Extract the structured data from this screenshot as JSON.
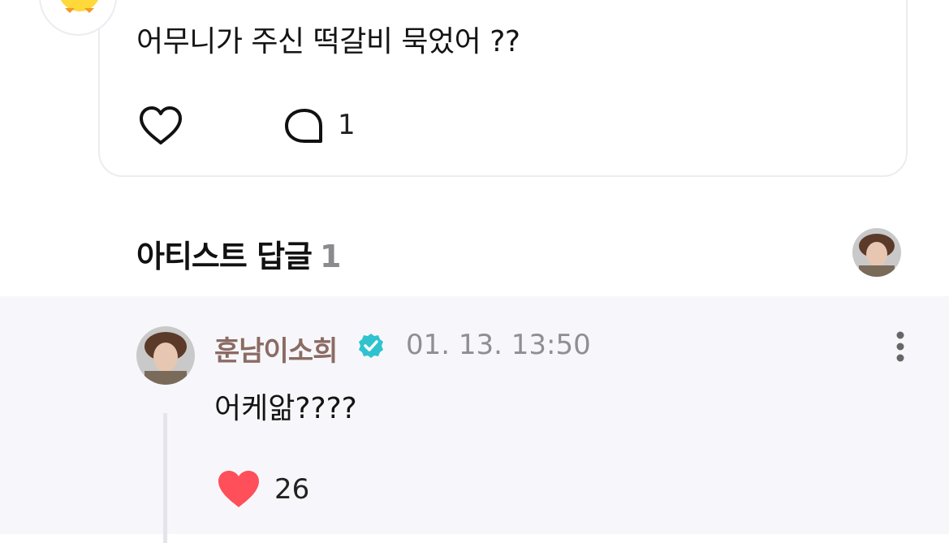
{
  "post": {
    "text": "어무니가 주신 떡갈비 묵었어 ??",
    "comment_count": "1",
    "author_avatar_icon": "chick-icon"
  },
  "artist_reply": {
    "header_label": "아티스트 답글",
    "header_count": "1"
  },
  "reply": {
    "author": "훈남이소희",
    "time": "01. 13. 13:50",
    "text": "어케앎????",
    "like_count": "26",
    "verified_color": "#2fc3cf",
    "like_color": "#ff4f5a",
    "author_color": "#8b6b63"
  }
}
